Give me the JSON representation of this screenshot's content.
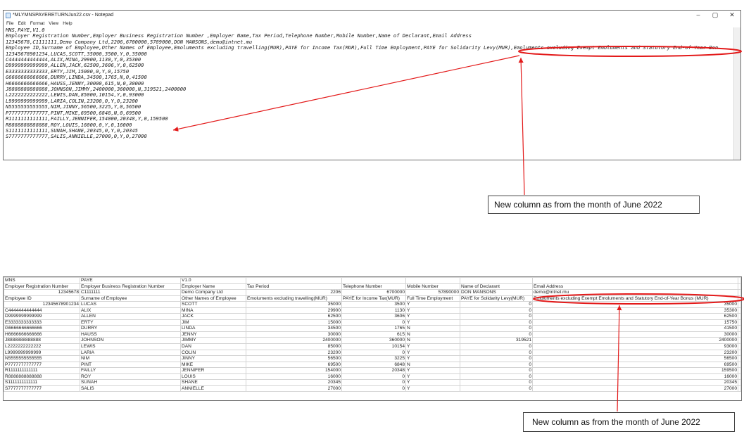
{
  "notepad": {
    "title": "*MLYMNSPAYERETURNJun22.csv - Notepad",
    "menu": [
      "File",
      "Edit",
      "Format",
      "View",
      "Help"
    ],
    "controls": {
      "minimize": "–",
      "maximize": "▢",
      "close": "✕"
    },
    "lines": [
      "MNS,PAYE,V1.0",
      "Employer Registration Number,Employer Business Registration Number ,Employer Name,Tax Period,Telephone Number,Mobile Number,Name of Declarant,Email Address",
      "12345678,C1111111,Demo Company Ltd,2206,6700000,5789000,DON MANSONS,demo@intnet.mu",
      "Employee ID,Surname of Employee,Other Names of Employee,Emoluments excluding travelling(MUR),PAYE for Income Tax(MUR),Full Time Employment,PAYE for Solidarity Levy(MUR),Emoluments excluding Exempt Emoluments and Statutory End-of-Year Bon",
      "12345678901234,LUCAS,SCOTT,35000,3500,Y,0,35000",
      "C4444444444444,ALIX,MINA,29900,1130,Y,0,35300",
      "D9999999999999,ALLEN,JACK,62500,3606,Y,0,62500",
      "E3333333333333,ERTY,JIM,15000,0,Y,0,15750",
      "G6666666666666,DURRY,LINDA,34500,1765,N,0,41500",
      "H6666666666666,HAUSS,JENNY,30000,615,N,0,30000",
      "J8888888888888,JOHNSON,JIMMY,2400000,360000,N,319521,2400000",
      "L2222222222222,LEWIS,DAN,85000,10154,Y,0,93000",
      "L9999999999999,LARIA,COLIN,23200,0,Y,0,23200",
      "N5555555555555,NIM,JINNY,56500,3225,Y,0,56500",
      "P7777777777777,PINT,MIKE,69500,6848,N,0,69500",
      "R1111111111111,FAILLY,JENNIFER,154000,20348,Y,0,159500",
      "R8888888888888,ROY,LOUIS,16000,0,Y,0,16000",
      "S1111111111111,SUNAH,SHANE,20345,0,Y,0,20345",
      "S7777777777777,SALIS,ANNIELLE,27000,0,Y,0,27000"
    ]
  },
  "callouts": {
    "top": "New column as from the month of June 2022",
    "bottom": "New column as from the month of June 2022"
  },
  "excel": {
    "header_rows": [
      [
        "MNS",
        "PAYE",
        "V1.0",
        "",
        "",
        "",
        "",
        "",
        ""
      ],
      [
        "Employer Registration Number",
        "Employer Business Registration Number",
        "Employer Name",
        "Tax Period",
        "Telephone Number",
        "Mobile Number",
        "Name of Declarant",
        "Email Address",
        ""
      ],
      [
        "12345678",
        "C1111111",
        "Demo Company Ltd",
        "2206",
        "6700000",
        "57890000",
        "DON MANSONS",
        "demo@intnet.mu",
        ""
      ],
      [
        "Employee ID",
        "Surname of Employee",
        "Other Names of Employee",
        "Emoluments excluding travelling(MUR)",
        "PAYE for Income Tax(MUR)",
        "Full Time Employment",
        "PAYE for Solidarity Levy(MUR)",
        "Emoluments excluding Exempt Emoluments and Statutory End-of-Year Bonus (MUR)",
        ""
      ]
    ],
    "rows": [
      [
        "12345678901234",
        "LUCAS",
        "SCOTT",
        "35000",
        "3500",
        "Y",
        "0",
        "35000"
      ],
      [
        "C4444444444444",
        "ALIX",
        "MINA",
        "29900",
        "1130",
        "Y",
        "0",
        "35300"
      ],
      [
        "D9999999999999",
        "ALLEN",
        "JACK",
        "62500",
        "3606",
        "Y",
        "0",
        "62500"
      ],
      [
        "E3333333333333",
        "ERTY",
        "JIM",
        "15000",
        "0",
        "Y",
        "0",
        "15750"
      ],
      [
        "G6666666666666",
        "DURRY",
        "LINDA",
        "34500",
        "1765",
        "N",
        "0",
        "41500"
      ],
      [
        "H6666666666666",
        "HAUSS",
        "JENNY",
        "30000",
        "615",
        "N",
        "0",
        "30000"
      ],
      [
        "J8888888888888",
        "JOHNSON",
        "JIMMY",
        "2400000",
        "360000",
        "N",
        "319521",
        "2400000"
      ],
      [
        "L2222222222222",
        "LEWIS",
        "DAN",
        "85000",
        "10154",
        "Y",
        "0",
        "93000"
      ],
      [
        "L9999999999999",
        "LARIA",
        "COLIN",
        "23200",
        "0",
        "Y",
        "0",
        "23200"
      ],
      [
        "N5555555555555",
        "NIM",
        "JINNY",
        "56500",
        "3225",
        "Y",
        "0",
        "56500"
      ],
      [
        "P7777777777777",
        "PINT",
        "MIKE",
        "69500",
        "6848",
        "N",
        "0",
        "69500"
      ],
      [
        "R1111111111111",
        "FAILLY",
        "JENNIFER",
        "154000",
        "20348",
        "Y",
        "0",
        "159500"
      ],
      [
        "R8888888888888",
        "ROY",
        "LOUIS",
        "16000",
        "0",
        "Y",
        "0",
        "16000"
      ],
      [
        "S1111111111111",
        "SUNAH",
        "SHANE",
        "20345",
        "0",
        "Y",
        "0",
        "20345"
      ],
      [
        "S7777777777777",
        "SALIS",
        "ANNIELLE",
        "27000",
        "0",
        "Y",
        "0",
        "27000"
      ]
    ]
  },
  "colors": {
    "annotation": "#e31a1a"
  }
}
